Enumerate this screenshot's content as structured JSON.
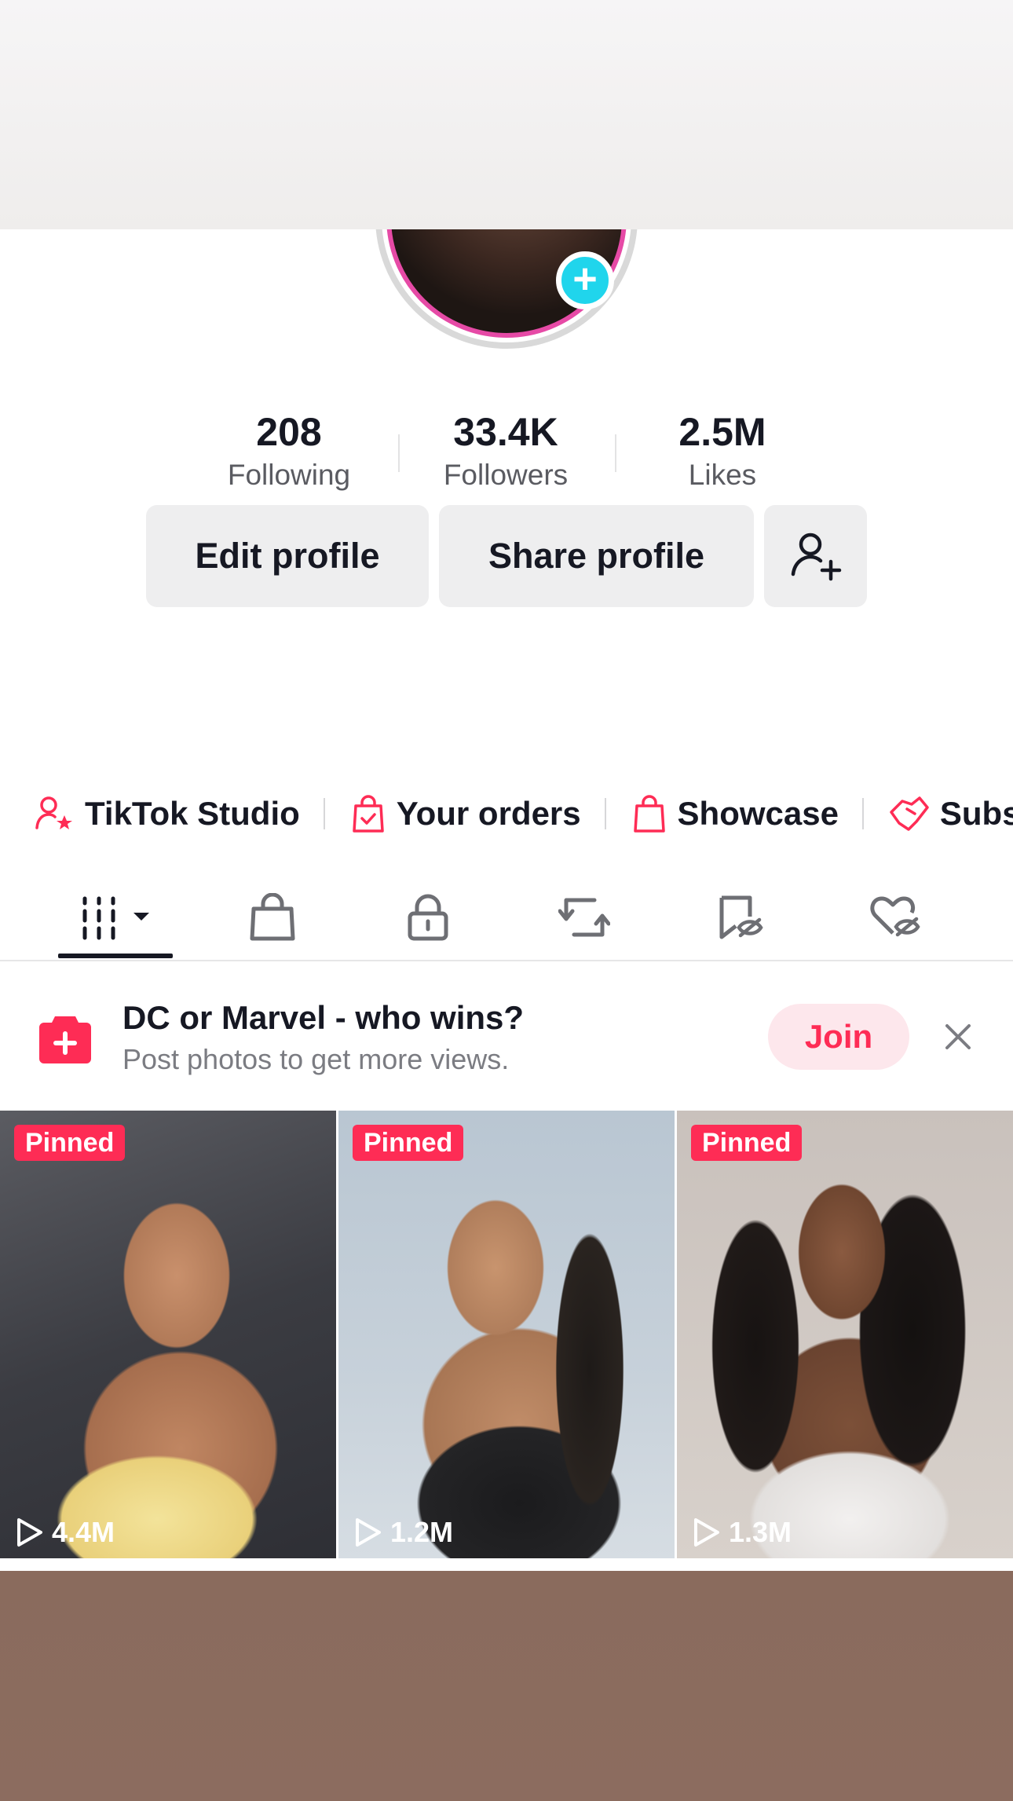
{
  "stats": [
    {
      "value": "208",
      "label": "Following"
    },
    {
      "value": "33.4K",
      "label": "Followers"
    },
    {
      "value": "2.5M",
      "label": "Likes"
    }
  ],
  "buttons": {
    "edit": "Edit profile",
    "share": "Share profile"
  },
  "links": [
    {
      "label": "TikTok Studio",
      "icon": "person-star-icon"
    },
    {
      "label": "Your orders",
      "icon": "shopping-bag-check-icon"
    },
    {
      "label": "Showcase",
      "icon": "shopping-bag-icon"
    },
    {
      "label": "Subscr",
      "icon": "handshake-icon"
    }
  ],
  "tabs": [
    {
      "icon": "videos-grid-icon",
      "active": true
    },
    {
      "icon": "shopping-bag-icon"
    },
    {
      "icon": "lock-icon"
    },
    {
      "icon": "repost-icon"
    },
    {
      "icon": "bookmark-hidden-icon"
    },
    {
      "icon": "liked-hidden-icon"
    }
  ],
  "banner": {
    "title": "DC or Marvel - who wins?",
    "subtitle": "Post photos to get more views.",
    "join": "Join"
  },
  "videos": [
    {
      "badge": "Pinned",
      "views": "4.4M"
    },
    {
      "badge": "Pinned",
      "views": "1.2M"
    },
    {
      "badge": "Pinned",
      "views": "1.3M"
    }
  ],
  "colors": {
    "accent": "#fe2c55",
    "avatar_plus": "#20d5ec",
    "avatar_ring": "#e64aa6"
  }
}
